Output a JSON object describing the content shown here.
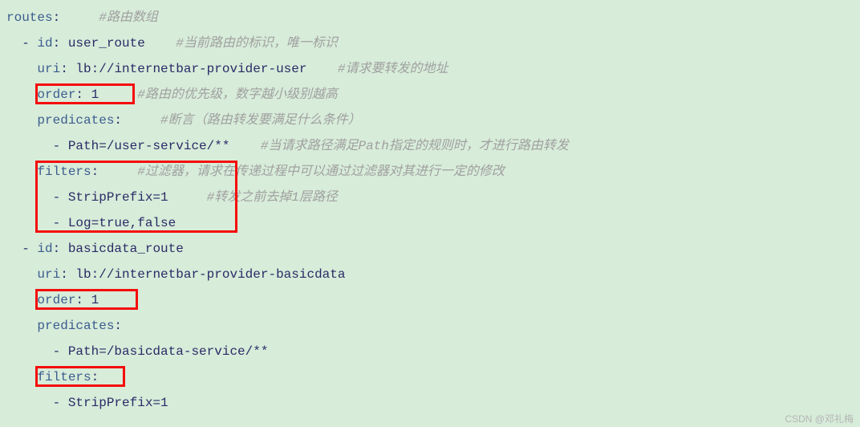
{
  "lines": {
    "l1_key": "routes",
    "l1_cmt": "#路由数组",
    "l2_dash": "  - ",
    "l2_key": "id",
    "l2_val": " user_route",
    "l2_cmt": "#当前路由的标识，唯一标识",
    "l3_key": "    uri",
    "l3_val": " lb://internetbar-provider-user",
    "l3_cmt": "#请求要转发的地址",
    "l4_key": "    order",
    "l4_val": " 1",
    "l4_cmt": "#路由的优先级，数字越小级别越高",
    "l5_key": "    predicates",
    "l5_cmt": "#断言（路由转发要满足什么条件）",
    "l6_dash": "      - ",
    "l6_val": "Path=/user-service/**",
    "l6_cmt": "#当请求路径满足Path指定的规则时，才进行路由转发",
    "l7_key": "    filters",
    "l7_cmt": "#过滤器，请求在传递过程中可以通过过滤器对其进行一定的修改",
    "l8_dash": "      - ",
    "l8_val": "StripPrefix=1",
    "l8_cmt": "#转发之前去掉1层路径",
    "l9_dash": "      - ",
    "l9_val": "Log=true,false",
    "l10_dash": "  - ",
    "l10_key": "id",
    "l10_val": " basicdata_route",
    "l11_key": "    uri",
    "l11_val": " lb://internetbar-provider-basicdata",
    "l12_key": "    order",
    "l12_val": " 1",
    "l13_key": "    predicates",
    "l14_dash": "      - ",
    "l14_val": "Path=/basicdata-service/**",
    "l15_key": "    filters",
    "l16_dash": "      - ",
    "l16_val": "StripPrefix=1"
  },
  "colon": ":",
  "sp3": "   ",
  "sp4": "    ",
  "sp5": "     ",
  "watermark": "CSDN @邓礼梅"
}
